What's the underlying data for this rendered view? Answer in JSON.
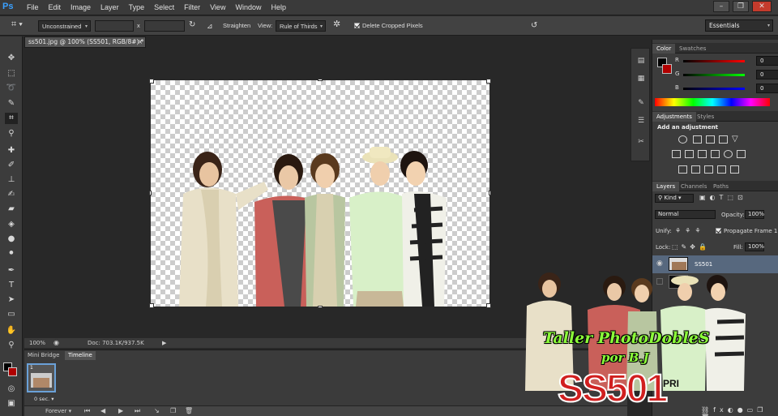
{
  "app": {
    "logo": "Ps"
  },
  "menu": [
    "File",
    "Edit",
    "Image",
    "Layer",
    "Type",
    "Select",
    "Filter",
    "View",
    "Window",
    "Help"
  ],
  "window_controls": {
    "minimize": "–",
    "restore": "❐",
    "close": "✕"
  },
  "options": {
    "ratio": "Unconstrained",
    "ratio_x": "x",
    "straighten_label": "Straighten",
    "view_label": "View:",
    "view_value": "Rule of Thirds",
    "delete_cropped": "Delete Cropped Pixels",
    "workspace": "Essentials"
  },
  "document": {
    "tab_title": "ss501.jpg @ 100% (SS501, RGB/8#) *",
    "zoom": "100%",
    "doc_size": "Doc: 703.1K/937.5K"
  },
  "bottom_panel": {
    "tabs": [
      "Mini Bridge",
      "Timeline"
    ],
    "frame_number": "1",
    "frame_delay": "0 sec.",
    "loop": "Forever"
  },
  "color_panel": {
    "tabs": [
      "Color",
      "Swatches"
    ],
    "r_label": "R",
    "g_label": "G",
    "b_label": "B",
    "r": "0",
    "g": "0",
    "b": "0",
    "colors": {
      "fg": "#000000",
      "bg": "#b00000"
    }
  },
  "adjustments_panel": {
    "tabs": [
      "Adjustments",
      "Styles"
    ],
    "heading": "Add an adjustment"
  },
  "layers_panel": {
    "tabs": [
      "Layers",
      "Channels",
      "Paths"
    ],
    "kind": "Kind",
    "blend_mode": "Normal",
    "opacity_label": "Opacity:",
    "opacity": "100%",
    "unify_label": "Unify:",
    "propagate": "Propagate Frame 1",
    "lock_label": "Lock:",
    "fill_label": "Fill:",
    "fill": "100%",
    "layers": [
      {
        "name": "SS501"
      },
      {
        "name": ""
      }
    ]
  },
  "watermark": {
    "title": "Taller PhotoDobleS",
    "subtitle": "por B.J",
    "logo": "SS501",
    "logo_suffix": "PRI"
  }
}
